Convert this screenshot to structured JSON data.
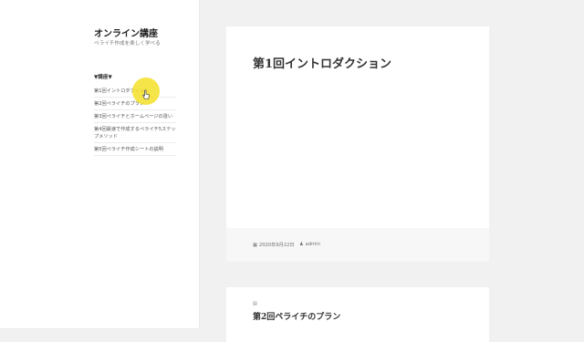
{
  "site": {
    "title": "オンライン講座",
    "description": "ペライチ作成を楽しく学べる"
  },
  "sidebar": {
    "widget_title": "▼講座▼",
    "items": [
      {
        "label": "第1回イントロダクション"
      },
      {
        "label": "第2回ペライチのプラン"
      },
      {
        "label": "第3回ペライチとホームページの違い"
      },
      {
        "label": "第4回最速で作成するペライチ5ステップメソッド"
      },
      {
        "label": "第5回ペライチ作成シートの説明"
      }
    ]
  },
  "post": {
    "title": "第1回イントロダクション",
    "date_icon": "calendar-icon",
    "date": "2020年9月22日",
    "author_icon": "user-icon",
    "author": "admin"
  },
  "next_post": {
    "format_icon": "document-icon",
    "title": "第2回ペライチのプラン"
  },
  "colors": {
    "highlight": "#f5e028",
    "background": "#f1f1f1",
    "card": "#ffffff"
  }
}
